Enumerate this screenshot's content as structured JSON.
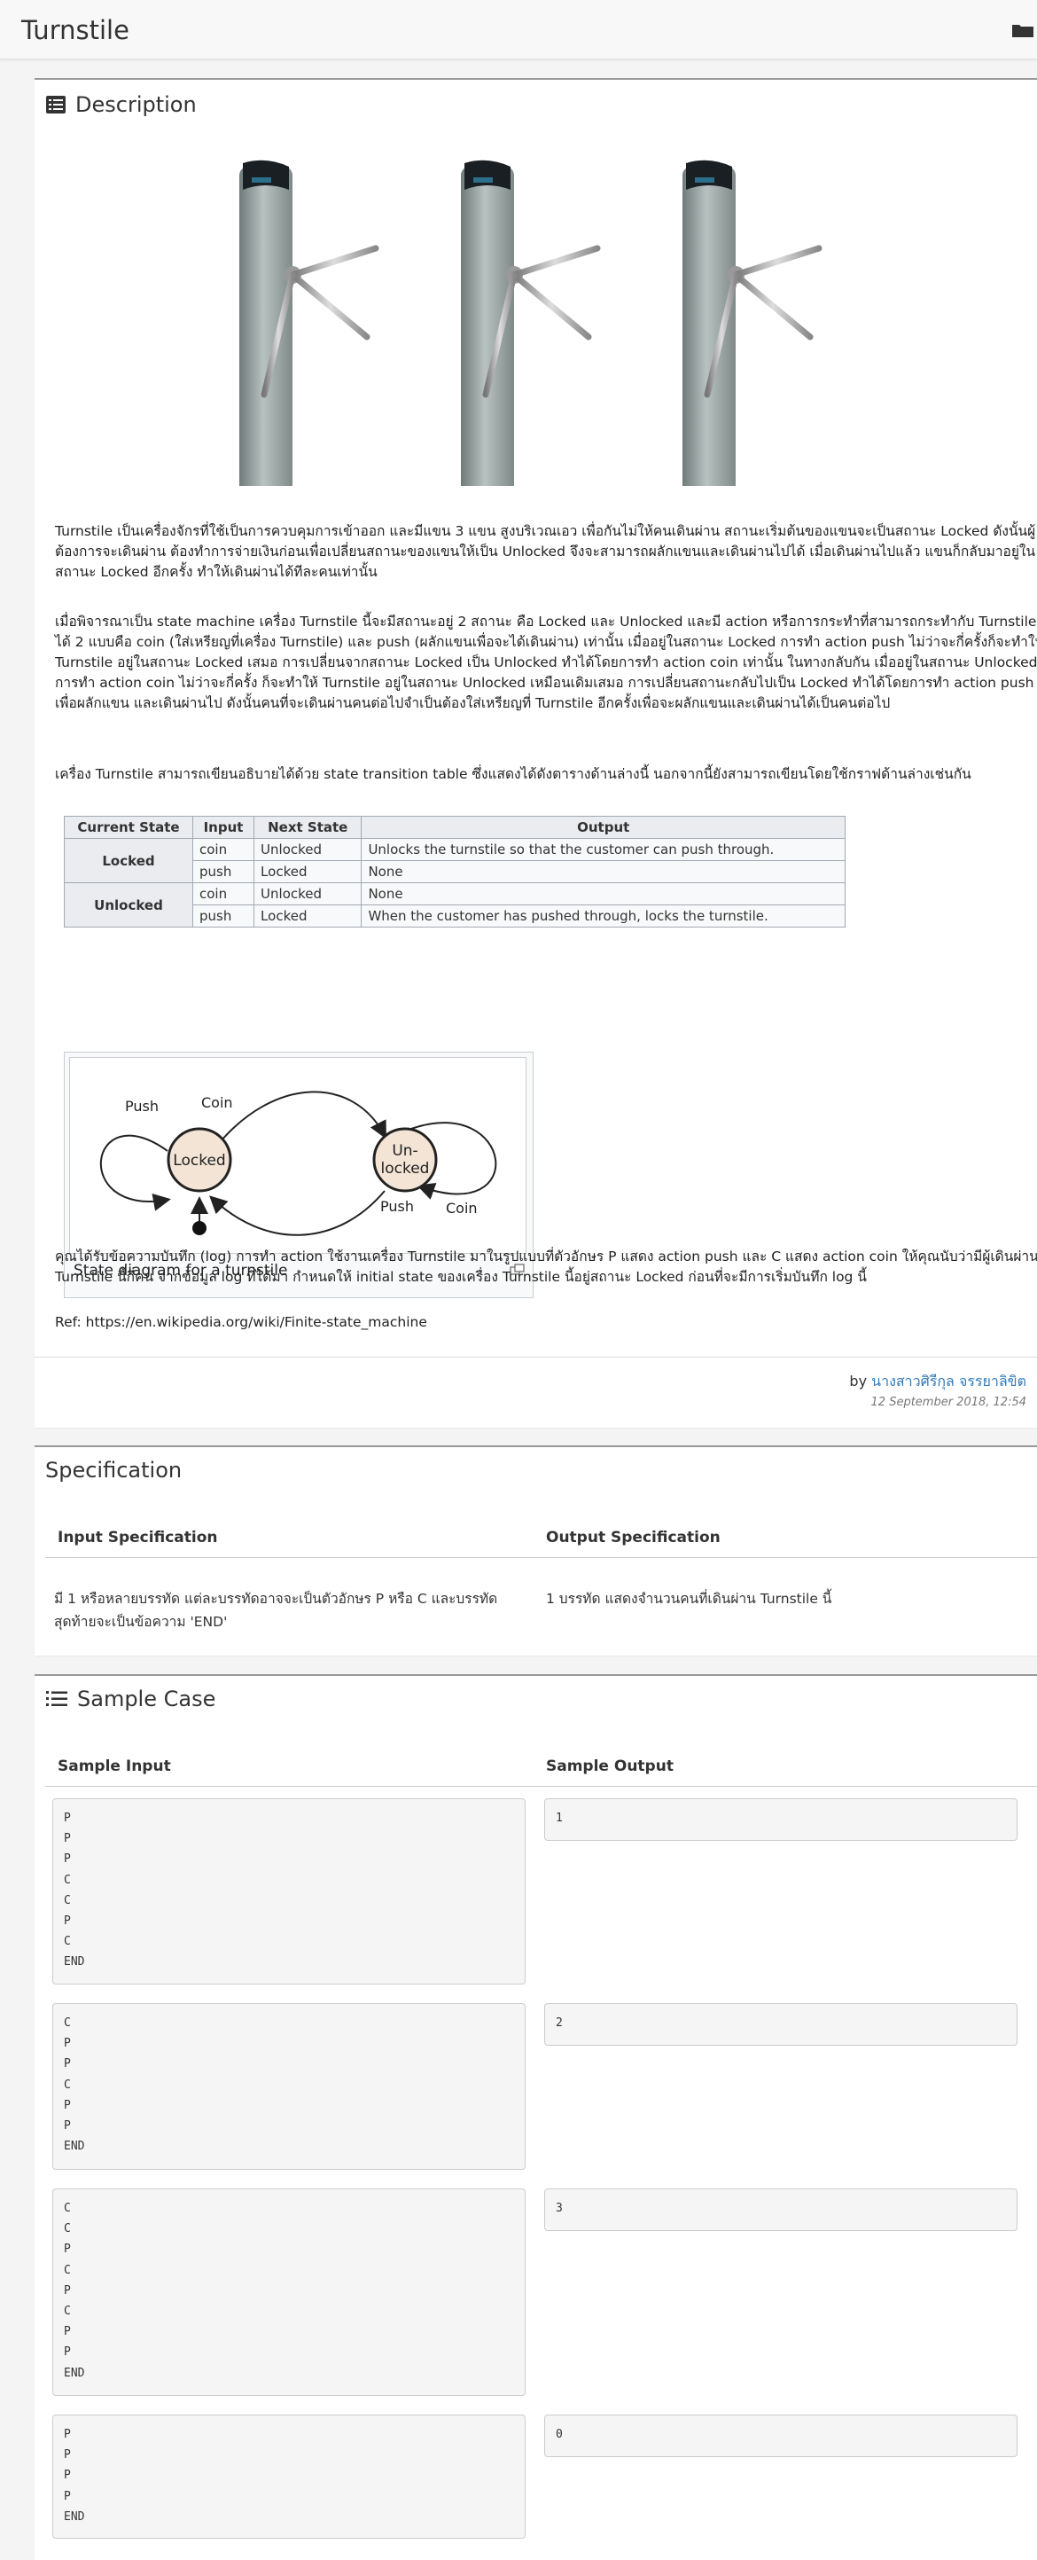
{
  "header": {
    "title": "Turnstile"
  },
  "description": {
    "heading": "Description",
    "paragraphs": [
      "Turnstile เป็นเครื่องจักรที่ใช้เป็นการควบคุมการเข้าออก และมีแขน 3 แขน สูงบริเวณเอว เพื่อกันไม่ให้คนเดินผ่าน สถานะเริ่มต้นของแขนจะเป็นสถานะ Locked ดังนั้นผู้ต้องการจะเดินผ่าน ต้องทำการจ่ายเงินก่อนเพื่อเปลี่ยนสถานะของแขนให้เป็น Unlocked จึงจะสามารถผลักแขนและเดินผ่านไปได้ เมื่อเดินผ่านไปแล้ว แขนก็กลับมาอยู่ในสถานะ Locked อีกครั้ง ทำให้เดินผ่านได้ทีละคนเท่านั้น",
      "เมื่อพิจารณาเป็น state machine เครื่อง Turnstile นี้จะมีสถานะอยู่ 2 สถานะ คือ Locked และ Unlocked และมี action หรือการกระทำที่สามารถกระทำกับ Turnstile ได้ 2 แบบคือ coin (ใส่เหรียญที่เครื่อง Turnstile) และ push (ผลักแขนเพื่อจะได้เดินผ่าน) เท่านั้น เมื่ออยู่ในสถานะ Locked การทำ action push ไม่ว่าจะกี่ครั้งก็จะทำให้ Turnstile อยู่ในสถานะ Locked เสมอ การเปลี่ยนจากสถานะ Locked เป็น Unlocked ทำได้โดยการทำ action coin เท่านั้น ในทางกลับกัน เมื่ออยู่ในสถานะ Unlocked การทำ action coin ไม่ว่าจะกี่ครั้ง ก็จะทำให้ Turnstile อยู่ในสถานะ Unlocked เหมือนเดิมเสมอ การเปลี่ยนสถานะกลับไปเป็น Locked ทำได้โดยการทำ action push เพื่อผลักแขน และเดินผ่านไป ดังนั้นคนที่จะเดินผ่านคนต่อไปจำเป็นต้องใส่เหรียญที่ Turnstile อีกครั้งเพื่อจะผลักแขนและเดินผ่านได้เป็นคนต่อไป",
      "เครื่อง Turnstile สามารถเขียนอธิบายได้ด้วย state transition table ซึ่งแสดงได้ดังตารางด้านล่างนี้ นอกจากนี้ยังสามารถเขียนโดยใช้กราฟด้านล่างเช่นกัน"
    ],
    "table": {
      "headers": [
        "Current State",
        "Input",
        "Next State",
        "Output"
      ],
      "locked": "Locked",
      "unlocked": "Unlocked",
      "rows": [
        {
          "input": "coin",
          "next": "Unlocked",
          "output": "Unlocks the turnstile so that the customer can push through."
        },
        {
          "input": "push",
          "next": "Locked",
          "output": "None"
        },
        {
          "input": "coin",
          "next": "Unlocked",
          "output": "None"
        },
        {
          "input": "push",
          "next": "Locked",
          "output": "When the customer has pushed through, locks the turnstile."
        }
      ]
    },
    "diagram": {
      "caption": "State diagram for a turnstile",
      "node_locked": "Locked",
      "node_unlocked_1": "Un-",
      "node_unlocked_2": "locked",
      "label_push_1": "Push",
      "label_coin_1": "Coin",
      "label_push_2": "Push",
      "label_coin_2": "Coin"
    },
    "paragraph_after": "คุณได้รับข้อความบันทึก (log) การทำ action ใช้งานเครื่อง Turnstile มาในรูปแบบที่ตัวอักษร P แสดง action push และ C แสดง action coin ให้คุณนับว่ามีผู้เดินผ่าน Turnstile นี้กี่คน จากข้อมูล log ที่ได้มา กำหนดให้ initial state ของเครื่อง Turnstile นี้อยู่สถานะ Locked ก่อนที่จะมีการเริ่มบันทึก log นี้",
    "ref": "Ref: https://en.wikipedia.org/wiki/Finite-state_machine",
    "author_prefix": "by",
    "author_name": "นางสาวศิรีกุล จรรยาลิขิต",
    "timestamp": "12 September 2018, 12:54"
  },
  "specification": {
    "heading": "Specification",
    "input_heading": "Input Specification",
    "output_heading": "Output Specification",
    "input_text": "มี 1 หรือหลายบรรทัด แต่ละบรรทัดอาจจะเป็นตัวอักษร P หรือ C และบรรทัดสุดท้ายจะเป็นข้อความ 'END'",
    "output_text": "1 บรรทัด แสดงจำนวนคนที่เดินผ่าน Turnstile นี้"
  },
  "samples": {
    "heading": "Sample Case",
    "input_heading": "Sample Input",
    "output_heading": "Sample Output",
    "cases": [
      {
        "input": "P\nP\nP\nC\nC\nP\nC\nEND",
        "output": "1"
      },
      {
        "input": "C\nP\nP\nC\nP\nP\nEND",
        "output": "2"
      },
      {
        "input": "C\nC\nP\nC\nP\nC\nP\nP\nEND",
        "output": "3"
      },
      {
        "input": "P\nP\nP\nP\nEND",
        "output": "0"
      }
    ]
  },
  "colors": {
    "link": "#337ab7",
    "table_header": "#eaecf0",
    "node_fill": "#f3e4d6"
  }
}
